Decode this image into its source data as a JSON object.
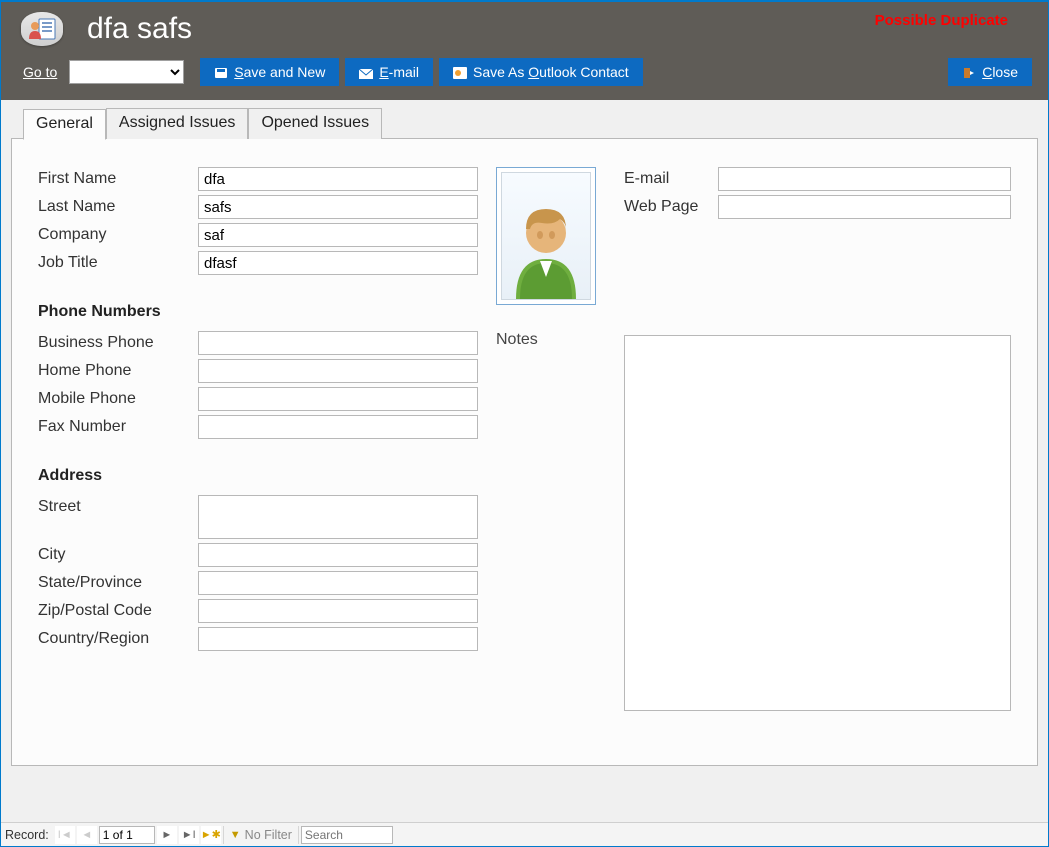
{
  "header": {
    "title": "dfa safs",
    "duplicate_warning": "Possible Duplicate",
    "goto_label_prefix": "G",
    "goto_label_rest": "o to",
    "buttons": {
      "save_new_pre": "S",
      "save_new_rest": "ave and New",
      "email_pre": "E",
      "email_rest": "-mail",
      "save_outlook_pre": "Save As ",
      "save_outlook_u": "O",
      "save_outlook_rest": "utlook Contact",
      "close_pre": "C",
      "close_rest": "lose"
    }
  },
  "tabs": {
    "general": "General",
    "assigned": "Assigned Issues",
    "opened": "Opened Issues"
  },
  "labels": {
    "first_name": "First Name",
    "last_name": "Last Name",
    "company": "Company",
    "job_title": "Job Title",
    "phone_heading": "Phone Numbers",
    "business_phone": "Business Phone",
    "home_phone": "Home Phone",
    "mobile_phone": "Mobile Phone",
    "fax": "Fax Number",
    "address_heading": "Address",
    "street": "Street",
    "city": "City",
    "state": "State/Province",
    "zip": "Zip/Postal Code",
    "country": "Country/Region",
    "email": "E-mail",
    "webpage": "Web Page",
    "notes": "Notes"
  },
  "values": {
    "first_name": "dfa",
    "last_name": "safs",
    "company": "saf",
    "job_title": "dfasf",
    "business_phone": "",
    "home_phone": "",
    "mobile_phone": "",
    "fax": "",
    "street": "",
    "city": "",
    "state": "",
    "zip": "",
    "country": "",
    "email": "",
    "webpage": "",
    "notes": ""
  },
  "statusbar": {
    "record_label": "Record:",
    "record_value": "1 of 1",
    "no_filter": "No Filter",
    "search_placeholder": "Search"
  }
}
